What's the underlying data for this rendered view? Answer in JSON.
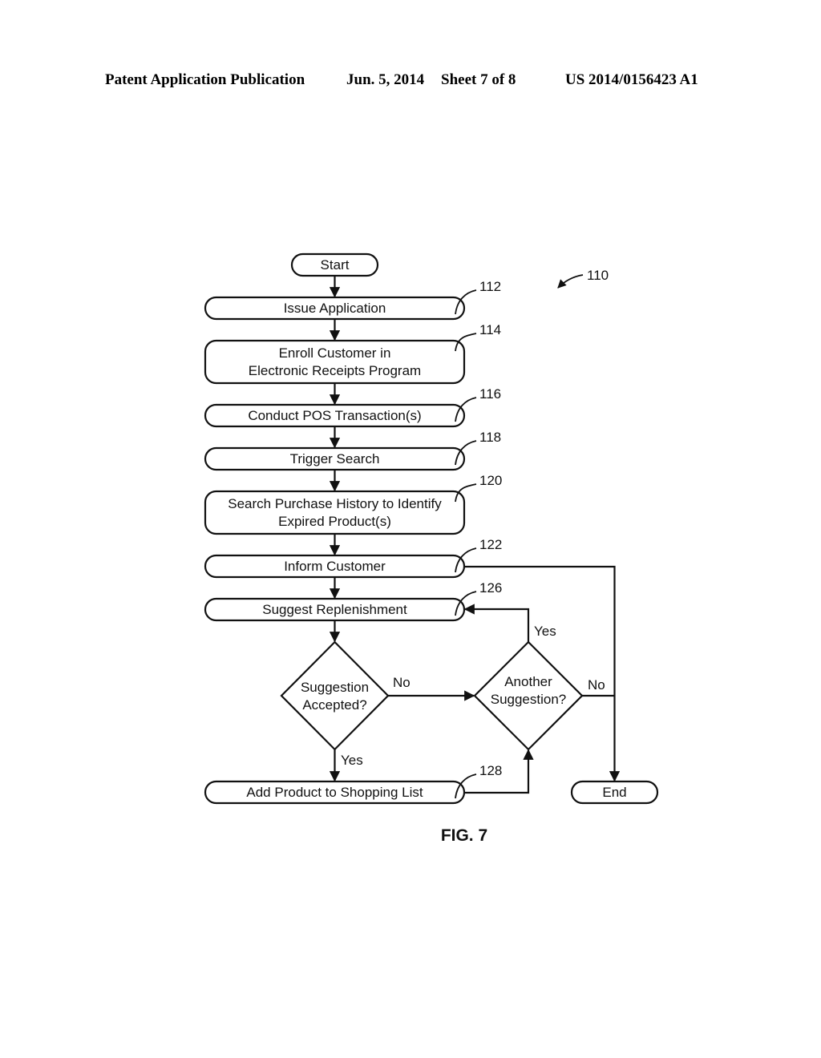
{
  "header": {
    "left": "Patent Application Publication",
    "date": "Jun. 5, 2014",
    "sheet": "Sheet 7 of 8",
    "number": "US 2014/0156423 A1"
  },
  "figure": {
    "label": "FIG. 7",
    "ref": "110",
    "start": "Start",
    "end": "End",
    "steps": [
      {
        "ref": "112",
        "lines": [
          "Issue Application"
        ]
      },
      {
        "ref": "114",
        "lines": [
          "Enroll Customer in",
          "Electronic Receipts Program"
        ]
      },
      {
        "ref": "116",
        "lines": [
          "Conduct POS Transaction(s)"
        ]
      },
      {
        "ref": "118",
        "lines": [
          "Trigger Search"
        ]
      },
      {
        "ref": "120",
        "lines": [
          "Search Purchase History to Identify",
          "Expired Product(s)"
        ]
      },
      {
        "ref": "122",
        "lines": [
          "Inform Customer"
        ]
      },
      {
        "ref": "126",
        "lines": [
          "Suggest Replenishment"
        ]
      },
      {
        "ref": "128",
        "lines": [
          "Add Product to Shopping List"
        ]
      }
    ],
    "decisions": {
      "accepted": {
        "lines": [
          "Suggestion",
          "Accepted?"
        ],
        "no": "No",
        "yes": "Yes"
      },
      "another": {
        "lines": [
          "Another",
          "Suggestion?"
        ],
        "no": "No",
        "yes": "Yes"
      }
    }
  }
}
